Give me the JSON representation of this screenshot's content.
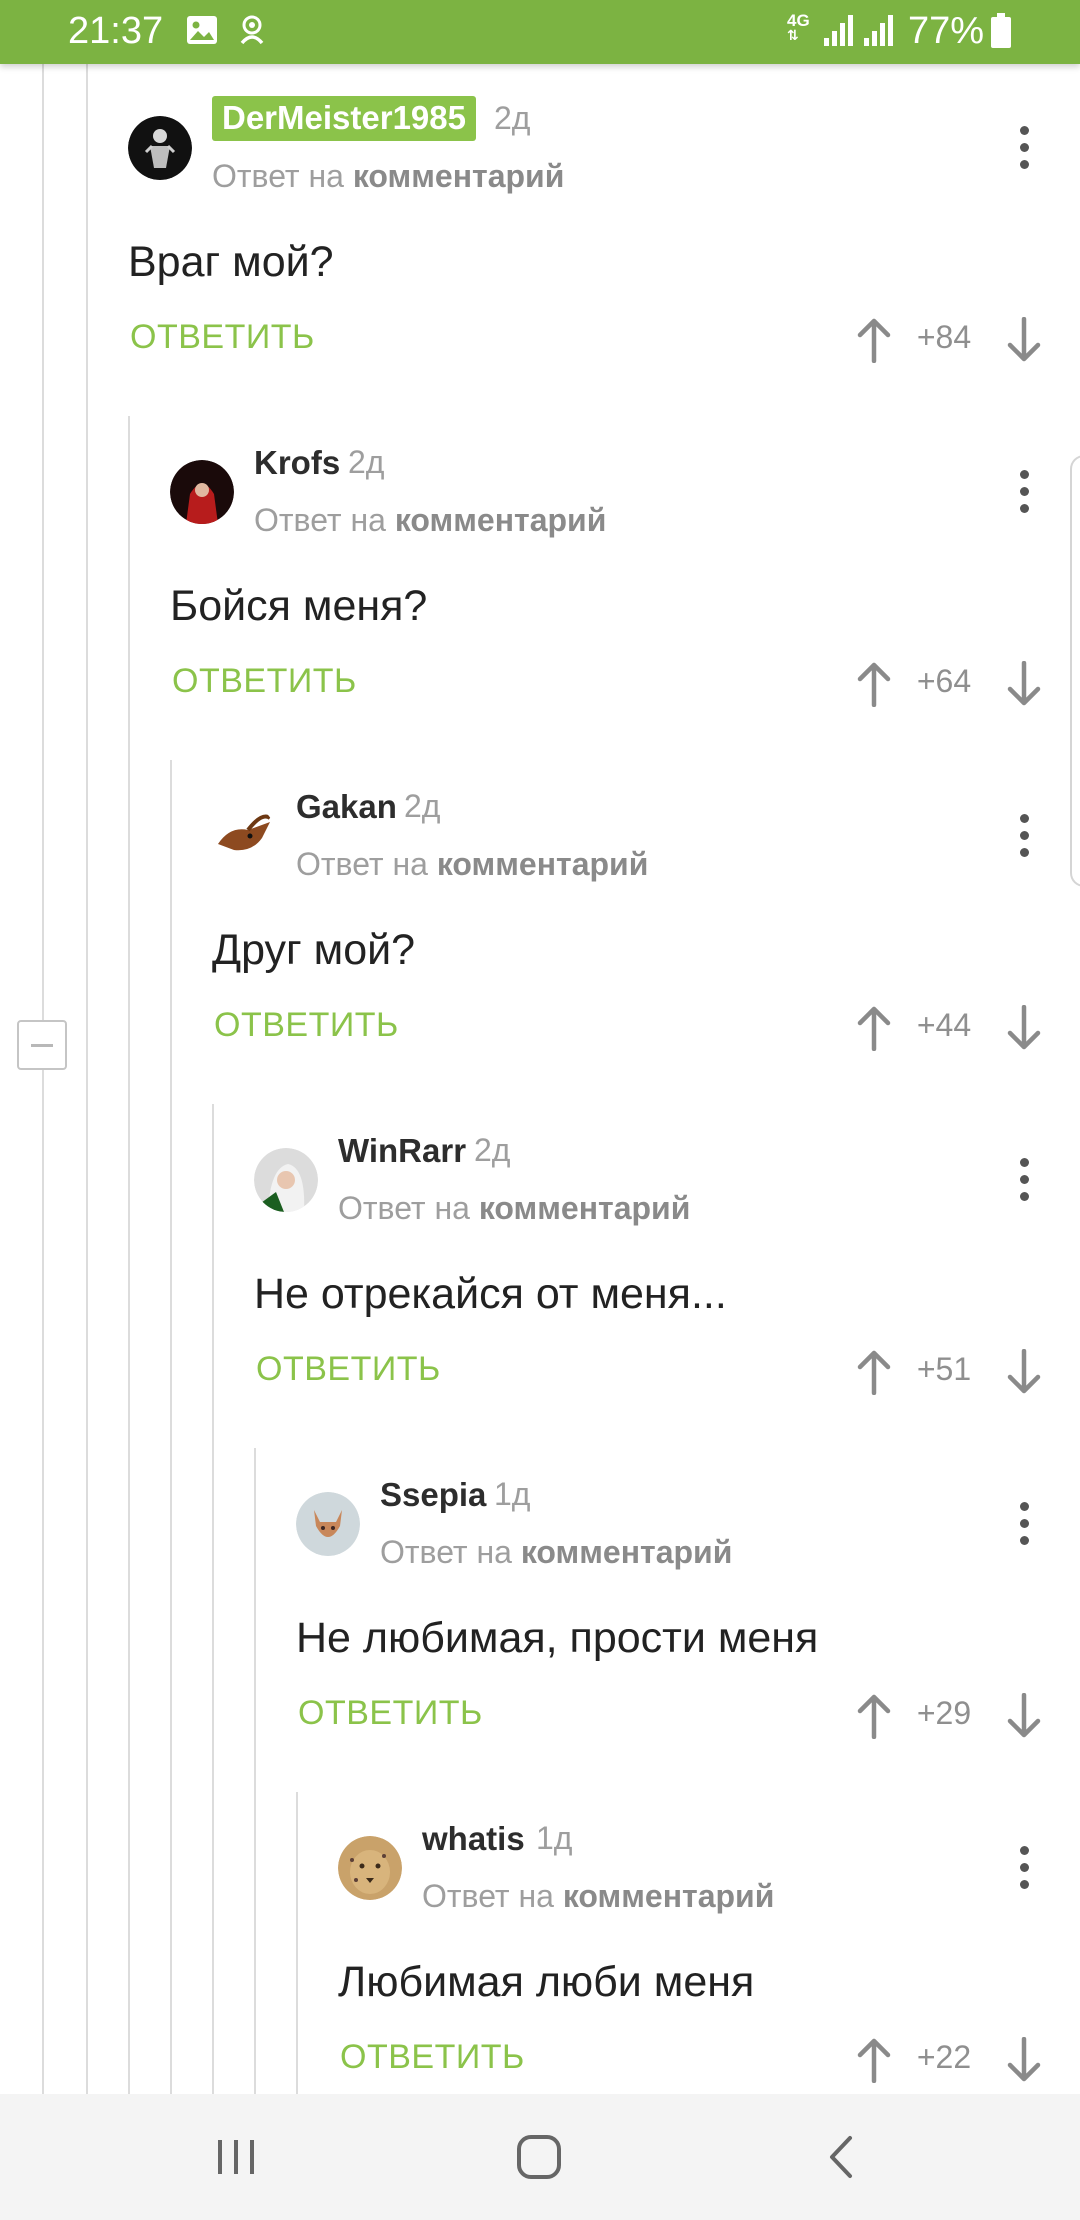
{
  "status_bar": {
    "time": "21:37",
    "network": "4G",
    "battery": "77%",
    "icons": [
      "image-icon",
      "whatsapp-icon",
      "signal-icon",
      "signal-icon",
      "battery-icon"
    ]
  },
  "colors": {
    "accent": "#8bc34a",
    "status_bar": "#7cb342",
    "muted_text": "#9e9e9e"
  },
  "comments": [
    {
      "username": "DerMeister1985",
      "is_author": true,
      "time": "2д",
      "reply_prefix": "Ответ на",
      "reply_link": "комментарий",
      "text": "Враг мой?",
      "reply_label": "ОТВЕТИТЬ",
      "score": "+84"
    },
    {
      "username": "Krofs",
      "is_author": false,
      "time": "2д",
      "reply_prefix": "Ответ на",
      "reply_link": "комментарий",
      "text": "Бойся меня?",
      "reply_label": "ОТВЕТИТЬ",
      "score": "+64"
    },
    {
      "username": "Gakan",
      "is_author": false,
      "time": "2д",
      "reply_prefix": "Ответ на",
      "reply_link": "комментарий",
      "text": "Друг мой?",
      "reply_label": "ОТВЕТИТЬ",
      "score": "+44"
    },
    {
      "username": "WinRarr",
      "is_author": false,
      "time": "2д",
      "reply_prefix": "Ответ на",
      "reply_link": "комментарий",
      "text": "Не отрекайся от меня...",
      "reply_label": "ОТВЕТИТЬ",
      "score": "+51"
    },
    {
      "username": "Ssepia",
      "is_author": false,
      "time": "1д",
      "reply_prefix": "Ответ на",
      "reply_link": "комментарий",
      "text": "Не любимая, прости меня",
      "reply_label": "ОТВЕТИТЬ",
      "score": "+29"
    },
    {
      "username": "whatis",
      "is_author": false,
      "time": "1д",
      "reply_prefix": "Ответ на",
      "reply_link": "комментарий",
      "text": "Любимая люби меня",
      "reply_label": "ОТВЕТИТЬ",
      "score": "+22"
    }
  ],
  "nav_bar": {
    "icons": [
      "recent-apps-icon",
      "home-icon",
      "back-icon"
    ]
  }
}
